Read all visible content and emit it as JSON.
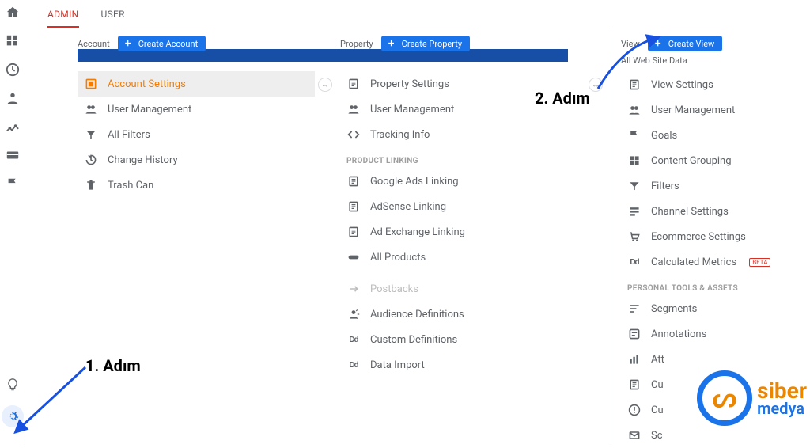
{
  "tabs": {
    "admin": "ADMIN",
    "user": "USER"
  },
  "account": {
    "label": "Account",
    "create": "Create Account",
    "items": [
      {
        "icon": "settings",
        "label": "Account Settings",
        "active": true
      },
      {
        "icon": "people",
        "label": "User Management"
      },
      {
        "icon": "filter",
        "label": "All Filters"
      },
      {
        "icon": "history",
        "label": "Change History"
      },
      {
        "icon": "trash",
        "label": "Trash Can"
      }
    ]
  },
  "property": {
    "label": "Property",
    "create": "Create Property",
    "items": [
      {
        "icon": "page",
        "label": "Property Settings"
      },
      {
        "icon": "people",
        "label": "User Management"
      },
      {
        "icon": "code",
        "label": "Tracking Info"
      }
    ],
    "section1": "PRODUCT LINKING",
    "linking": [
      {
        "icon": "page",
        "label": "Google Ads Linking"
      },
      {
        "icon": "page",
        "label": "AdSense Linking"
      },
      {
        "icon": "page",
        "label": "Ad Exchange Linking"
      },
      {
        "icon": "chain",
        "label": "All Products"
      }
    ],
    "more": [
      {
        "icon": "postback",
        "label": "Postbacks",
        "disabled": true
      },
      {
        "icon": "audience",
        "label": "Audience Definitions"
      },
      {
        "icon": "dd",
        "label": "Custom Definitions"
      },
      {
        "icon": "dd",
        "label": "Data Import"
      }
    ]
  },
  "view": {
    "label": "View",
    "create": "Create View",
    "subhead": "All Web Site Data",
    "items": [
      {
        "icon": "page",
        "label": "View Settings"
      },
      {
        "icon": "people",
        "label": "User Management"
      },
      {
        "icon": "flag",
        "label": "Goals"
      },
      {
        "icon": "grid",
        "label": "Content Grouping"
      },
      {
        "icon": "filter",
        "label": "Filters"
      },
      {
        "icon": "channel",
        "label": "Channel Settings"
      },
      {
        "icon": "cart",
        "label": "Ecommerce Settings"
      },
      {
        "icon": "dd",
        "label": "Calculated Metrics",
        "beta": "BETA"
      }
    ],
    "section1": "PERSONAL TOOLS & ASSETS",
    "tools": [
      {
        "icon": "segments",
        "label": "Segments"
      },
      {
        "icon": "note",
        "label": "Annotations"
      },
      {
        "icon": "bars",
        "label": "Att"
      },
      {
        "icon": "page",
        "label": "Cu"
      },
      {
        "icon": "alert",
        "label": "Cu"
      },
      {
        "icon": "mail",
        "label": "Sc"
      }
    ]
  },
  "annotations": {
    "step1": "1. Adım",
    "step2": "2. Adım"
  },
  "logo": {
    "line1": "siber",
    "line2": "medya"
  }
}
